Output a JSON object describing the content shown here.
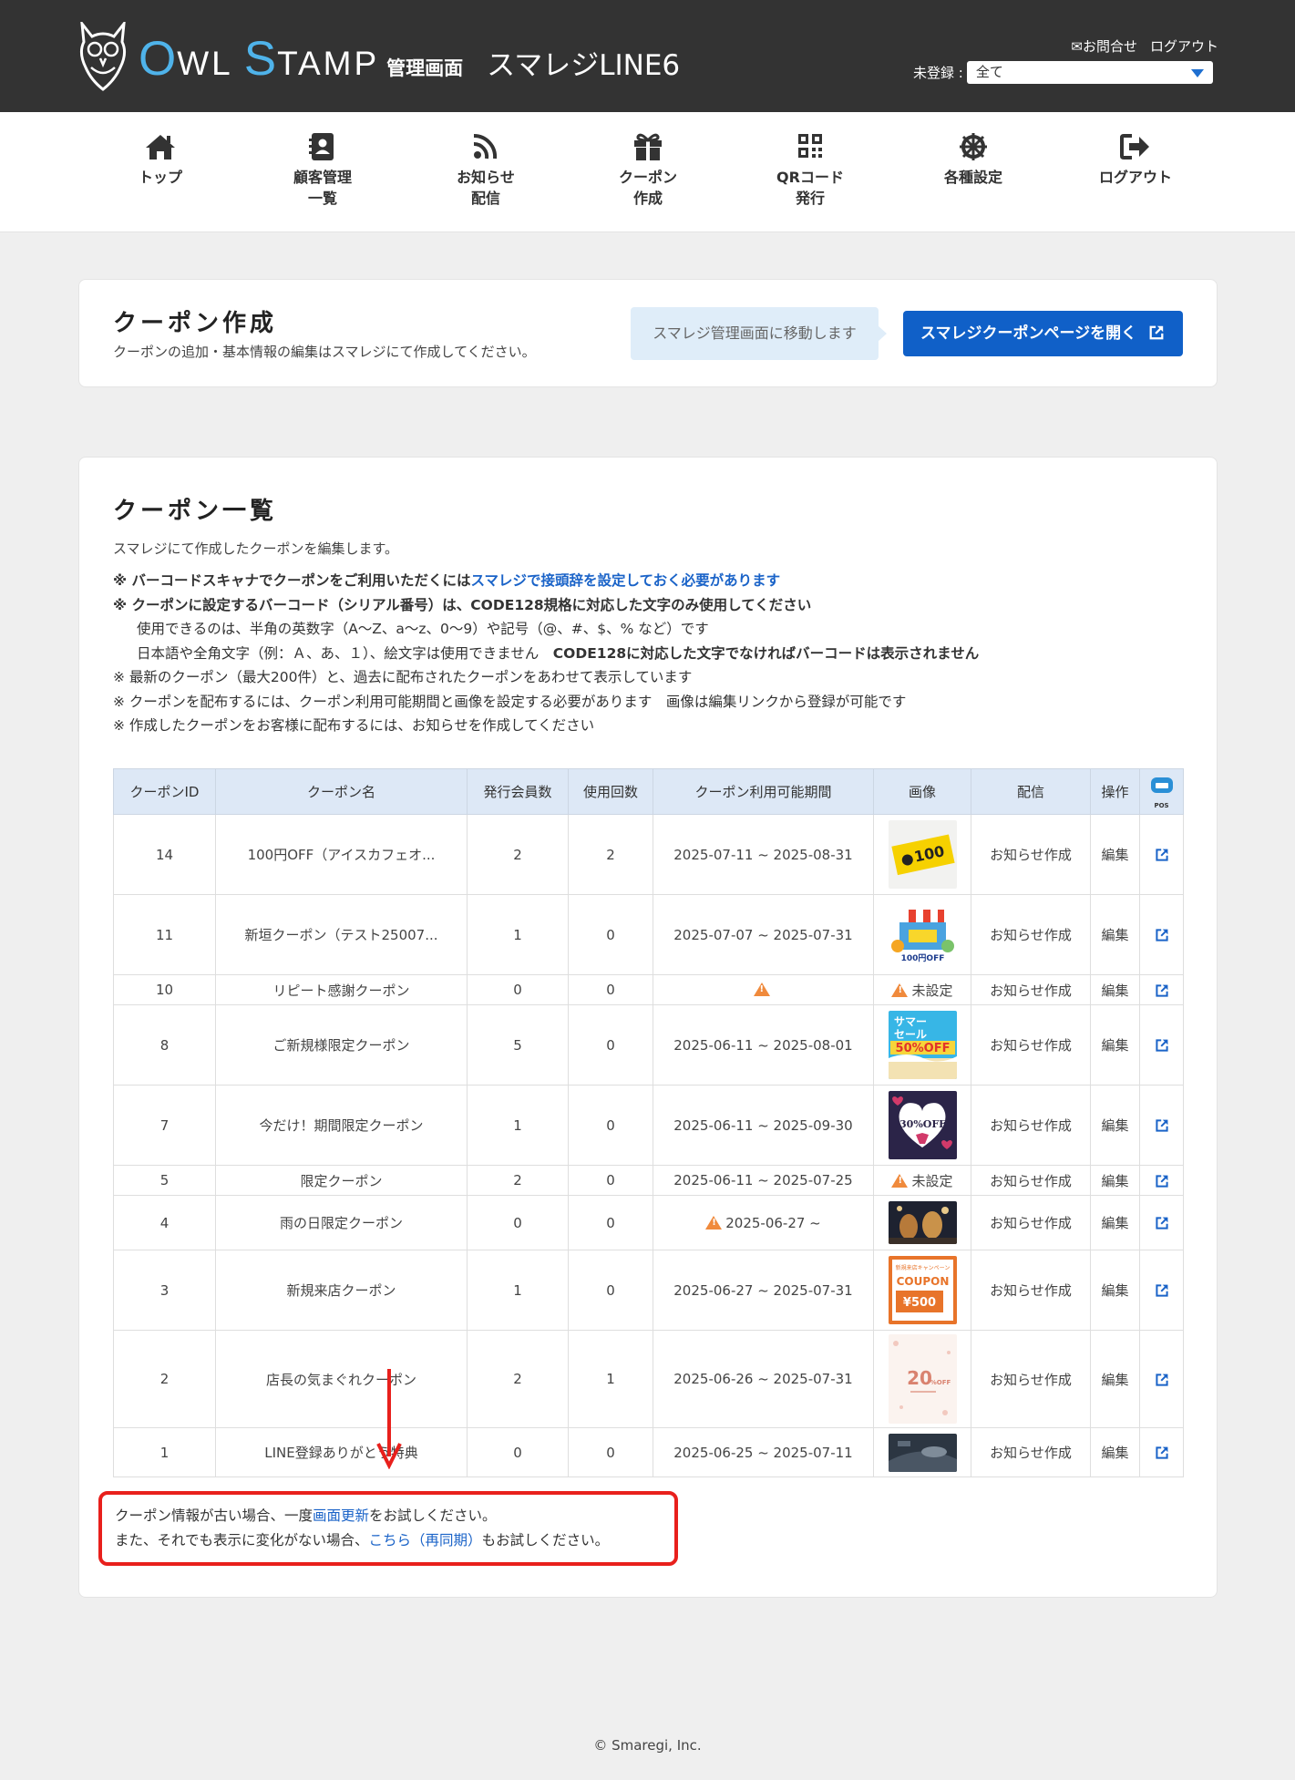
{
  "header": {
    "brand_o": "O",
    "brand_wl": "WL",
    "brand_s": "S",
    "brand_tamp": "TAMP",
    "brand_sub": "管理画面",
    "store_name": "スマレジLINE6",
    "contact": "✉お問合せ",
    "logout": "ログアウト",
    "filter_label": "未登録 :",
    "filter_value": "全て"
  },
  "nav": [
    {
      "label1": "トップ",
      "label2": "",
      "icon": "home-icon"
    },
    {
      "label1": "顧客管理",
      "label2": "一覧",
      "icon": "contact-book-icon"
    },
    {
      "label1": "お知らせ",
      "label2": "配信",
      "icon": "rss-icon"
    },
    {
      "label1": "クーポン",
      "label2": "作成",
      "icon": "gift-icon"
    },
    {
      "label1": "QRコード",
      "label2": "発行",
      "icon": "qr-code-icon"
    },
    {
      "label1": "各種設定",
      "label2": "",
      "icon": "settings-wheel-icon"
    },
    {
      "label1": "ログアウト",
      "label2": "",
      "icon": "sign-out-icon"
    }
  ],
  "create_card": {
    "title": "クーポン作成",
    "desc": "クーポンの追加・基本情報の編集はスマレジにて作成してください。",
    "tip": "スマレジ管理画面に移動します",
    "button": "スマレジクーポンページを開く"
  },
  "list_card": {
    "title": "クーポン一覧",
    "desc": "スマレジにて作成したクーポンを編集します。",
    "note1_a": "※ バーコードスキャナでクーポンをご利用いただくには",
    "note1_link": "スマレジで接頭辞を設定しておく必要があります",
    "note2": "※ クーポンに設定するバーコード（シリアル番号）は、CODE128規格に対応した文字のみ使用してください",
    "note3": "使用できるのは、半角の英数字（A〜Z、a〜z、0〜9）や記号（@、#、$、% など）です",
    "note4_a": "日本語や全角文字（例：Ａ、あ、１）、絵文字は使用できません　",
    "note4_b": "CODE128に対応した文字でなければバーコードは表示されません",
    "note5": "※ 最新のクーポン（最大200件）と、過去に配布されたクーポンをあわせて表示しています",
    "note6": "※ クーポンを配布するには、クーポン利用可能期間と画像を設定する必要があります　画像は編集リンクから登録が可能です",
    "note7": "※ 作成したクーポンをお客様に配布するには、お知らせを作成してください"
  },
  "table": {
    "headers": [
      "クーポンID",
      "クーポン名",
      "発行会員数",
      "使用回数",
      "クーポン利用可能期間",
      "画像",
      "配信",
      "操作",
      "POS"
    ],
    "rows": [
      {
        "id": "14",
        "name": "100円OFF（アイスカフェオ...",
        "members": "2",
        "uses": "2",
        "period": "2025-07-11 ~ 2025-08-31",
        "image": "yellow-100off",
        "delivery": "お知らせ作成",
        "op": "編集"
      },
      {
        "id": "11",
        "name": "新垣クーポン（テスト25007...",
        "members": "1",
        "uses": "0",
        "period": "2025-07-07 ~ 2025-07-31",
        "image": "shop-100off",
        "delivery": "お知らせ作成",
        "op": "編集"
      },
      {
        "id": "10",
        "name": "リピート感謝クーポン",
        "members": "0",
        "uses": "0",
        "period": "",
        "image": "none",
        "image_label": "未設定",
        "delivery": "お知らせ作成",
        "op": "編集"
      },
      {
        "id": "8",
        "name": "ご新規様限定クーポン",
        "members": "5",
        "uses": "0",
        "period": "2025-06-11 ~ 2025-08-01",
        "image": "summer-sale",
        "delivery": "お知らせ作成",
        "op": "編集"
      },
      {
        "id": "7",
        "name": "今だけ！期間限定クーポン",
        "members": "1",
        "uses": "0",
        "period": "2025-06-11 ~ 2025-09-30",
        "image": "hearts-30off",
        "delivery": "お知らせ作成",
        "op": "編集"
      },
      {
        "id": "5",
        "name": "限定クーポン",
        "members": "2",
        "uses": "0",
        "period": "2025-06-11 ~ 2025-07-25",
        "image": "none",
        "image_label": "未設定",
        "delivery": "お知らせ作成",
        "op": "編集"
      },
      {
        "id": "4",
        "name": "雨の日限定クーポン",
        "members": "0",
        "uses": "0",
        "period": "2025-06-27 ~",
        "image": "dark-photo",
        "delivery": "お知らせ作成",
        "op": "編集"
      },
      {
        "id": "3",
        "name": "新規来店クーポン",
        "members": "1",
        "uses": "0",
        "period": "2025-06-27 ~ 2025-07-31",
        "image": "coupon-500",
        "delivery": "お知らせ作成",
        "op": "編集"
      },
      {
        "id": "2",
        "name": "店長の気まぐれクーポン",
        "members": "2",
        "uses": "1",
        "period": "2025-06-26 ~ 2025-07-31",
        "image": "pink-20off",
        "delivery": "お知らせ作成",
        "op": "編集"
      },
      {
        "id": "1",
        "name": "LINE登録ありがとう特典",
        "members": "0",
        "uses": "0",
        "period": "2025-06-25 ~ 2025-07-11",
        "image": "car-photo",
        "delivery": "お知らせ作成",
        "op": "編集"
      }
    ],
    "thumb_texts": {
      "yellow": "100",
      "shop": "100円OFF",
      "summer1": "サマー",
      "summer2": "セール",
      "summer3": "50%OFF",
      "hearts": "30%OFF",
      "coupon_head": "新規来店キャンペーン",
      "coupon_word": "COUPON",
      "coupon_val": "¥500",
      "pink": "20",
      "pink_unit": "%OFF"
    }
  },
  "notice": {
    "line1_a": "クーポン情報が古い場合、一度",
    "line1_link": "画面更新",
    "line1_b": "をお試しください。",
    "line2_a": "また、それでも表示に変化がない場合、",
    "line2_link": "こちら（再同期）",
    "line2_b": "もお試しください。"
  },
  "footer": "© Smaregi, Inc.",
  "colors": {
    "header_bg": "#333333",
    "brand": "#4fb3ea",
    "accent": "#1060c8",
    "warn": "#f08a3c",
    "red": "#e8201c"
  }
}
